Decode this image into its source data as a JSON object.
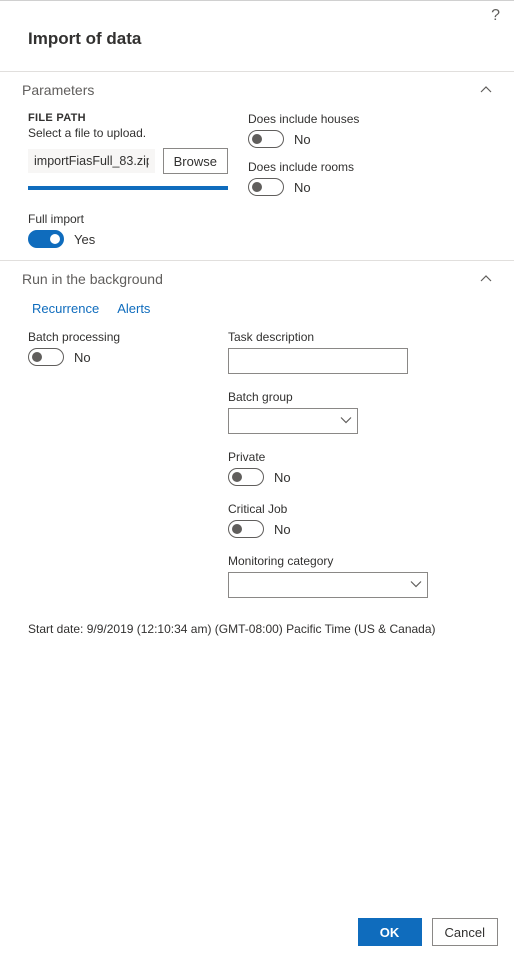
{
  "title": "Import of data",
  "sections": {
    "parameters": {
      "heading": "Parameters",
      "file_label": "FILE PATH",
      "file_hint": "Select a file to upload.",
      "file_value": "importFiasFull_83.zip",
      "browse_label": "Browse",
      "full_import": {
        "label": "Full import",
        "state": true,
        "text": "Yes"
      },
      "include_houses": {
        "label": "Does include houses",
        "state": false,
        "text": "No"
      },
      "include_rooms": {
        "label": "Does include rooms",
        "state": false,
        "text": "No"
      }
    },
    "background": {
      "heading": "Run in the background",
      "tabs": {
        "recurrence": "Recurrence",
        "alerts": "Alerts"
      },
      "batch_processing": {
        "label": "Batch processing",
        "state": false,
        "text": "No"
      },
      "task_description": {
        "label": "Task description",
        "value": ""
      },
      "batch_group": {
        "label": "Batch group",
        "value": ""
      },
      "private": {
        "label": "Private",
        "state": false,
        "text": "No"
      },
      "critical": {
        "label": "Critical Job",
        "state": false,
        "text": "No"
      },
      "monitoring": {
        "label": "Monitoring category",
        "value": ""
      }
    }
  },
  "start_date": "Start date: 9/9/2019 (12:10:34 am) (GMT-08:00) Pacific Time (US & Canada)",
  "footer": {
    "ok": "OK",
    "cancel": "Cancel"
  }
}
